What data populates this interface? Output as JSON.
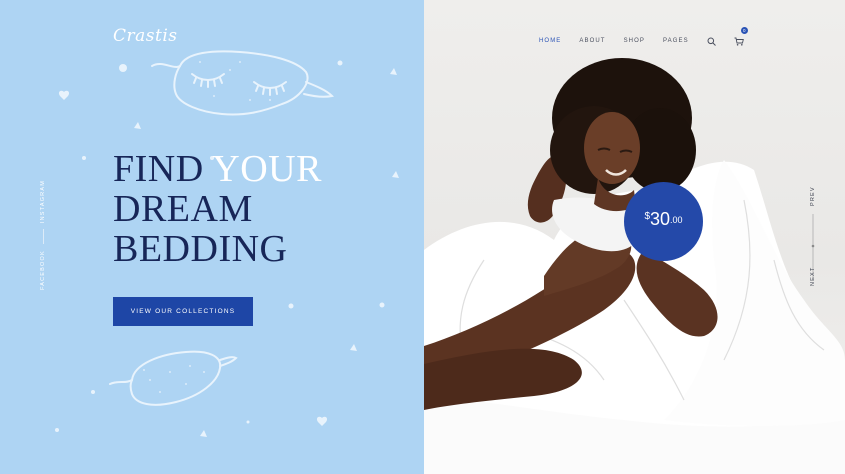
{
  "logo": {
    "text": "Crastis"
  },
  "hero": {
    "headline_1": "FIND ",
    "headline_highlight": "YOUR",
    "headline_2": "DREAM",
    "headline_3": "BEDDING",
    "cta_label": "VIEW OUR COLLECTIONS"
  },
  "social": {
    "instagram": "INSTAGRAM",
    "facebook": "FACEBOOK"
  },
  "nav": {
    "items": [
      {
        "label": "HOME",
        "active": true
      },
      {
        "label": "ABOUT",
        "active": false
      },
      {
        "label": "SHOP",
        "active": false
      },
      {
        "label": "PAGES",
        "active": false
      }
    ],
    "cart_count": "0"
  },
  "slider": {
    "prev": "PREV",
    "next": "NEXT"
  },
  "price": {
    "currency": "$",
    "amount": "30",
    "cents": ".00"
  },
  "colors": {
    "left_bg": "#aed4f3",
    "accent": "#1e46a6",
    "headline": "#172658"
  },
  "icons": [
    "search-icon",
    "cart-icon",
    "sleep-mask-icon",
    "heart-icon"
  ]
}
